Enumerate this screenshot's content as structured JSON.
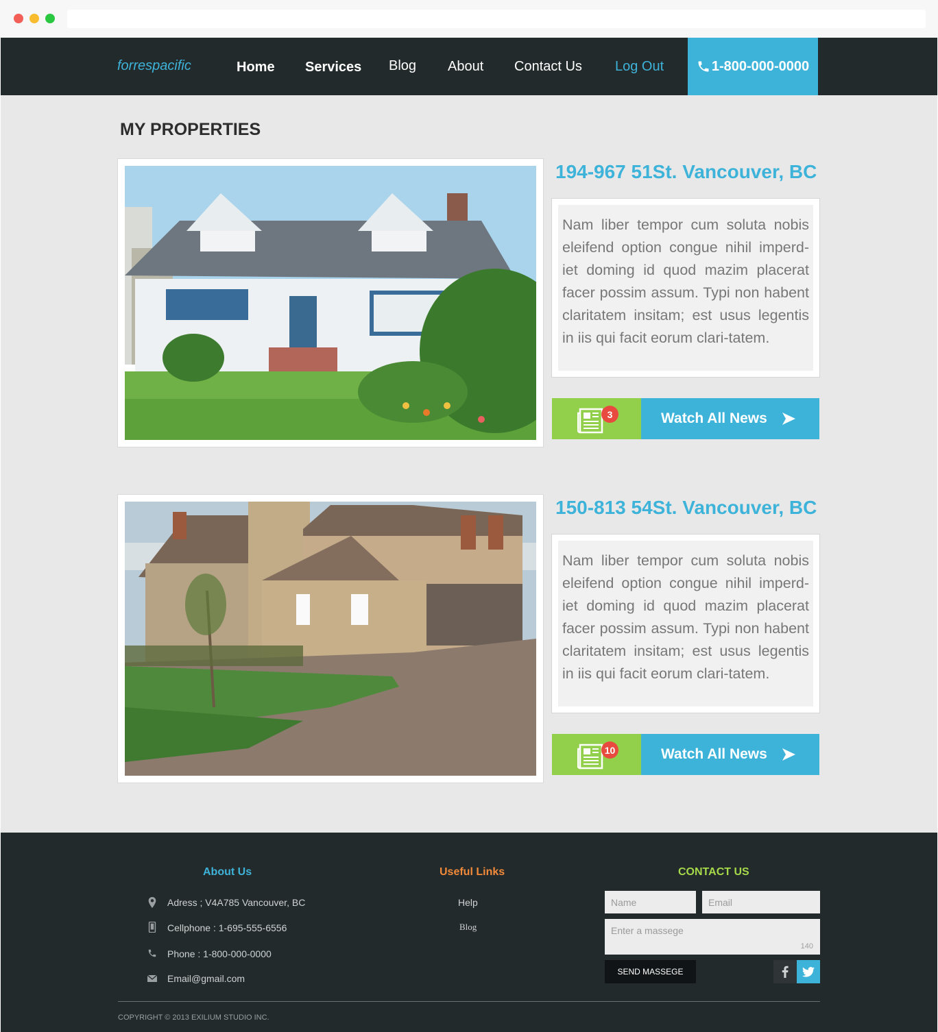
{
  "header": {
    "logo": "forrespacific",
    "nav": [
      "Home",
      "Services",
      "Blog",
      "About",
      "Contact Us",
      "Log Out"
    ],
    "phone": "1-800-000-0000",
    "colors": {
      "bar": "#232a2b",
      "accent": "#3eb3da"
    }
  },
  "main": {
    "title": "MY PROPERTIES",
    "properties": [
      {
        "address": "194-967 51St. Vancouver, BC",
        "description": "Nam liber tempor cum soluta nobis eleifend option congue nihil imperd-iet doming id quod mazim placerat facer possim assum. Typi non habent claritatem insitam; est usus legentis in iis qui facit eorum clari-tatem.",
        "news_count": "3",
        "news_label": "Watch All News"
      },
      {
        "address": "150-813 54St. Vancouver, BC",
        "description": "Nam liber tempor cum soluta nobis eleifend option congue nihil imperd-iet doming id quod mazim placerat facer possim assum. Typi non habent claritatem insitam; est usus legentis in iis qui facit eorum clari-tatem.",
        "news_count": "10",
        "news_label": "Watch All News"
      }
    ]
  },
  "footer": {
    "about": {
      "heading": "About Us",
      "address": "Adress ;  V4A785 Vancouver, BC",
      "cellphone": "Cellphone : 1-695-555-6556",
      "phone": "Phone : 1-800-000-0000",
      "email": "Email@gmail.com"
    },
    "links": {
      "heading": "Useful Links",
      "items": [
        "Help",
        "Blog"
      ]
    },
    "contact": {
      "heading": "CONTACT US",
      "name_placeholder": "Name",
      "email_placeholder": "Email",
      "message_placeholder": "Enter a massege",
      "char_count": "140",
      "send_label": "SEND MASSEGE"
    },
    "copyright": "COPYRIGHT © 2013 EXILIUM STUDIO INC.",
    "colors": {
      "about": "#3eb3da",
      "links": "#f28a3a",
      "contact": "#a6d94a"
    }
  }
}
